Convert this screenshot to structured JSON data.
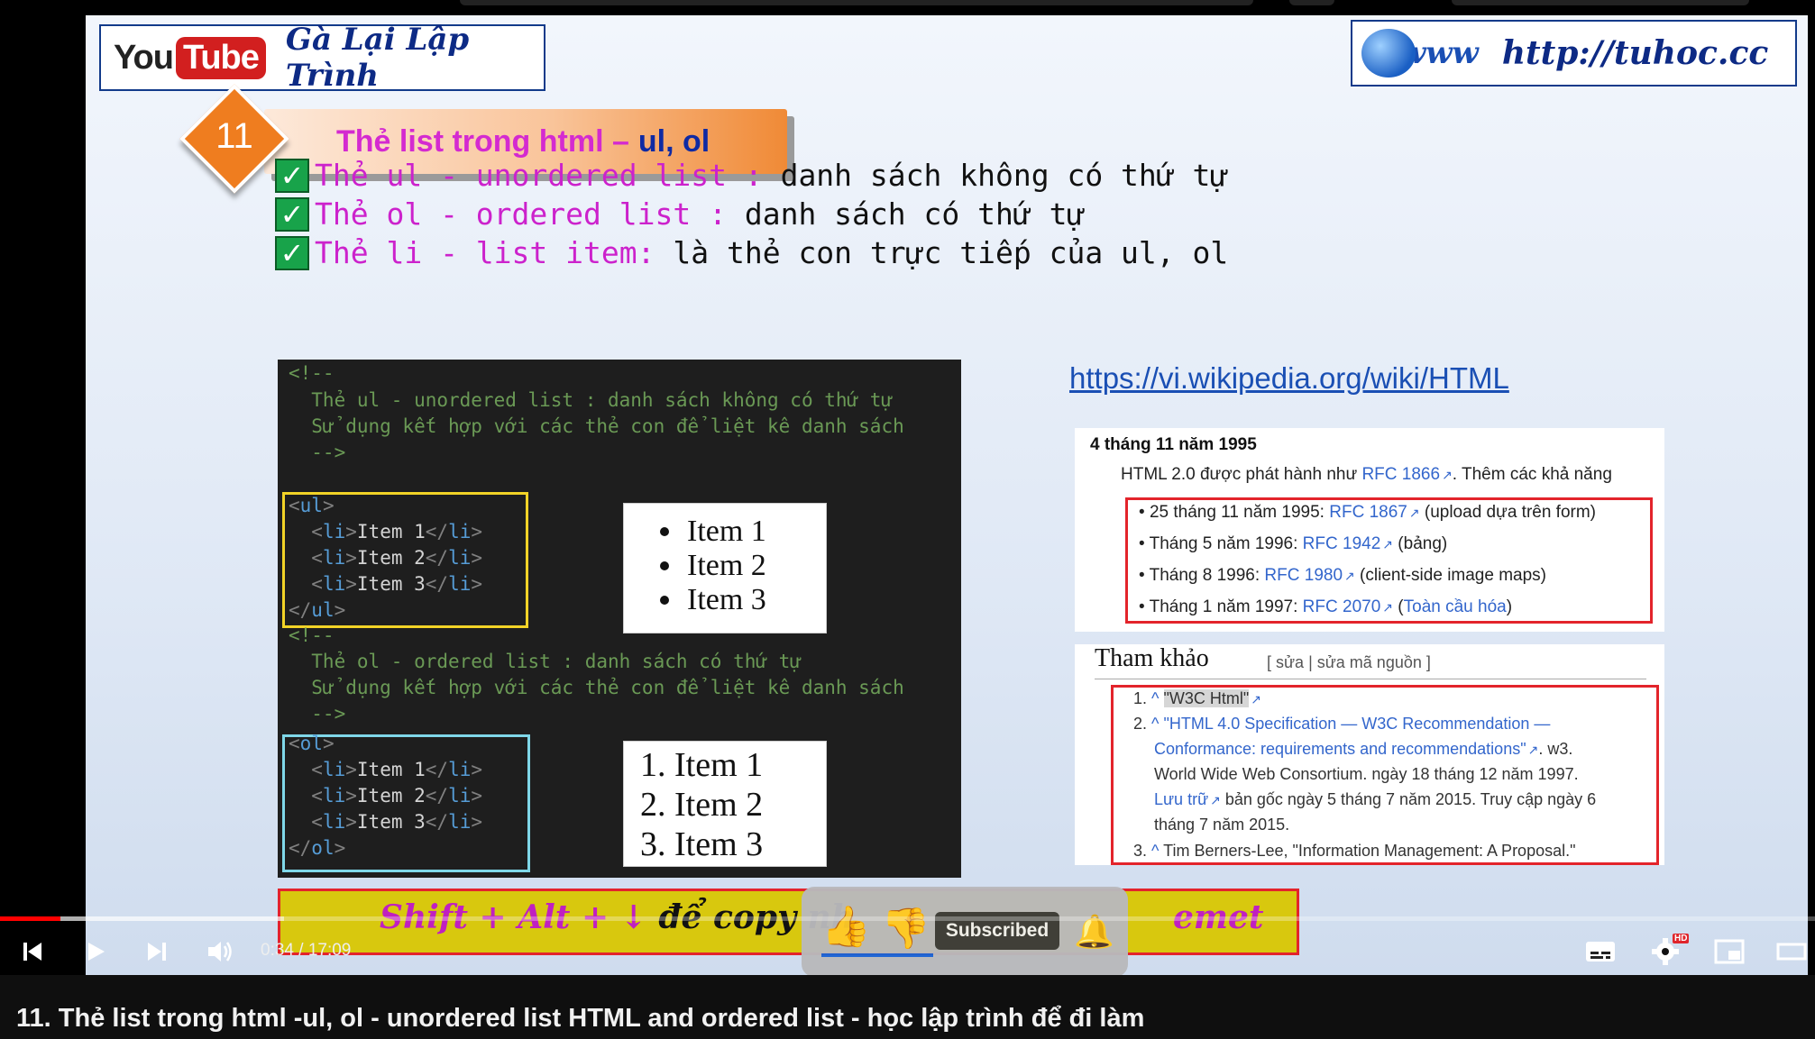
{
  "slide": {
    "brand": {
      "you": "You",
      "tube": "Tube",
      "name": "Gà Lại Lập Trình"
    },
    "site": {
      "www": "www",
      "url": "http://tuhoc.cc"
    },
    "lesson": {
      "number": "11",
      "title": "Thẻ list trong html –",
      "title_em": "ul, ol"
    },
    "bullets": [
      {
        "kw": "Thẻ ul - unordered list :",
        "desc": " danh sách không có thứ tự"
      },
      {
        "kw": "Thẻ ol - ordered list :",
        "desc": " danh sách có thứ tự"
      },
      {
        "kw": "Thẻ li - list item:",
        "desc": " là thẻ con trực tiếp của ul, ol"
      }
    ],
    "code": {
      "c1": "<!--",
      "c2": "  Thẻ ul - unordered list : danh sách không có thứ tự",
      "c3": "  Sử dụng kết hợp với các thẻ con để liệt kê danh sách",
      "c4": "  -->",
      "ul_open": "ul",
      "ul_close": "ul",
      "li": "li",
      "items": [
        "Item 1",
        "Item 2",
        "Item 3"
      ],
      "c5": "<!--",
      "c6": "  Thẻ ol - ordered list : danh sách có thứ tự",
      "c7": "  Sử dụng kết hợp với các thẻ con để liệt kê danh sách",
      "c8": "  -->",
      "ol_open": "ol",
      "ol_close": "ol"
    },
    "ul_render": [
      "Item 1",
      "Item 2",
      "Item 3"
    ],
    "ol_render": [
      "1. Item 1",
      "2. Item 2",
      "3. Item 3"
    ],
    "wiki_link": "https://vi.wikipedia.org/wiki/HTML",
    "wiki": {
      "date": "4 tháng 11 năm 1995",
      "intro_a": "HTML 2.0 được phát hành như ",
      "intro_link": "RFC 1866",
      "intro_b": ". Thêm các khả năng",
      "items": [
        {
          "pre": "25 tháng 11 năm 1995: ",
          "link": "RFC 1867",
          "post": " (upload dựa trên form)"
        },
        {
          "pre": "Tháng 5 năm 1996: ",
          "link": "RFC 1942",
          "post": " (bảng)"
        },
        {
          "pre": "Tháng 8 1996: ",
          "link": "RFC 1980",
          "post": " (client-side image maps)"
        },
        {
          "pre": "Tháng 1 năm 1997: ",
          "link": "RFC 2070",
          "post": " (",
          "link2": "Toàn cầu hóa",
          "post2": ")"
        }
      ]
    },
    "refs": {
      "title": "Tham khảo",
      "edit": "[ sửa | sửa mã nguồn ]",
      "r1_num": "1.",
      "r1_caret": "^",
      "r1_text": "\"W3C Html\"",
      "r2_num": "2.",
      "r2_caret": "^",
      "r2_l1": "\"HTML 4.0 Specification — W3C Recommendation —",
      "r2_l2a": "Conformance: requirements and recommendations\"",
      "r2_l2b": ". w3.",
      "r2_l3": "World Wide Web Consortium. ngày 18 tháng 12 năm 1997.",
      "r2_l4a": "Lưu trữ",
      "r2_l4b": " bản gốc ngày 5 tháng 7 năm 2015. Truy cập ngày 6",
      "r2_l5": "tháng 7 năm 2015.",
      "r3_num": "3.",
      "r3_caret": "^",
      "r3_text": " Tim Berners-Lee, \"Information Management: A Proposal.\""
    },
    "shortcut": {
      "a": "Shift + Alt + ↓ ",
      "b": "để copy nh",
      "c": "emet"
    }
  },
  "overlay": {
    "subscribe_label": "Subscribed"
  },
  "player": {
    "time": "0:34 / 17:09",
    "progress_fraction": 0.0331,
    "hd_badge": "HD",
    "colors": {
      "played": "#ff0000"
    }
  },
  "title": "11. Thẻ list trong html -ul, ol - unordered list HTML and ordered list - học lập trình để đi làm"
}
